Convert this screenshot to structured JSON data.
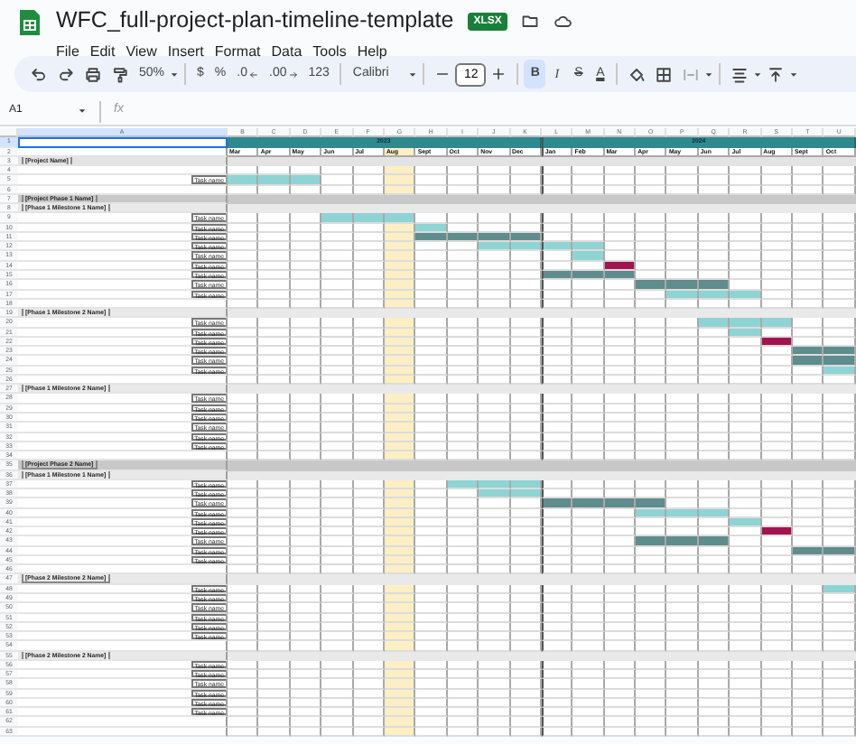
{
  "title": "WFC_full-project-plan-timeline-template",
  "file_badge": "XLSX",
  "menu": [
    "File",
    "Edit",
    "View",
    "Insert",
    "Format",
    "Data",
    "Tools",
    "Help"
  ],
  "toolbar": {
    "zoom": "50%",
    "currency": "$",
    "percent": "%",
    "decrease_decimal": ".0",
    "increase_decimal": ".00",
    "number_format": "123",
    "font": "Calibri",
    "font_size": "12",
    "styles": [
      {
        "label": "B",
        "kind": "bold",
        "selected": true
      },
      {
        "label": "I",
        "kind": "italic",
        "selected": false
      },
      {
        "label": "S",
        "kind": "strike",
        "selected": false
      },
      {
        "label": "A",
        "kind": "color",
        "selected": false
      }
    ]
  },
  "formula_bar": {
    "cell": "A1",
    "fx": "fx"
  },
  "column_letters": [
    "A",
    "B",
    "C",
    "D",
    "E",
    "F",
    "G",
    "H",
    "I",
    "J",
    "K",
    "L",
    "M",
    "N",
    "O",
    "P",
    "Q",
    "R",
    "S",
    "T",
    "U"
  ],
  "years": [
    {
      "label": "2023",
      "months": [
        {
          "label": "Mar",
          "highlighted": false
        },
        {
          "label": "Apr",
          "highlighted": false
        },
        {
          "label": "May",
          "highlighted": false
        },
        {
          "label": "Jun",
          "highlighted": false
        },
        {
          "label": "Jul",
          "highlighted": false
        },
        {
          "label": "Aug",
          "highlighted": true
        },
        {
          "label": "Sept",
          "highlighted": false
        },
        {
          "label": "Oct",
          "highlighted": false
        },
        {
          "label": "Nov",
          "highlighted": false
        },
        {
          "label": "Dec",
          "highlighted": false
        }
      ]
    },
    {
      "label": "2024",
      "months": [
        {
          "label": "Jan",
          "highlighted": false
        },
        {
          "label": "Feb",
          "highlighted": false
        },
        {
          "label": "Mar",
          "highlighted": false
        },
        {
          "label": "Apr",
          "highlighted": false
        },
        {
          "label": "May",
          "highlighted": false
        },
        {
          "label": "Jun",
          "highlighted": false
        },
        {
          "label": "Jul",
          "highlighted": false
        },
        {
          "label": "Aug",
          "highlighted": false
        },
        {
          "label": "Sept",
          "highlighted": false
        },
        {
          "label": "Oct",
          "highlighted": false
        }
      ]
    }
  ],
  "rows": [
    {
      "num": "1",
      "kind": "years",
      "selected": true
    },
    {
      "num": "2",
      "kind": "months",
      "selected": false
    },
    {
      "num": "3",
      "kind": "project",
      "label": "[Project Name]",
      "selected": false
    },
    {
      "num": "4",
      "kind": "blank",
      "selected": false
    },
    {
      "num": "5",
      "kind": "task",
      "label": "Task name",
      "selected": false,
      "color": "#8fd4d4",
      "shaded": [
        true,
        true,
        true,
        false,
        false,
        false,
        false,
        false,
        false,
        false,
        false,
        false,
        false,
        false,
        false,
        false,
        false,
        false,
        false,
        false
      ]
    },
    {
      "num": "6",
      "kind": "blank",
      "selected": false
    },
    {
      "num": "7",
      "kind": "phase",
      "label": "[Project Phase 1 Name]",
      "selected": false
    },
    {
      "num": "8",
      "kind": "milestone",
      "label": "[Phase 1 Milestone 1 Name]",
      "selected": false
    },
    {
      "num": "9",
      "kind": "task",
      "label": "Task name",
      "selected": false,
      "color": "#8fd4d4",
      "shaded": [
        false,
        false,
        false,
        true,
        true,
        true,
        false,
        false,
        false,
        false,
        false,
        false,
        false,
        false,
        false,
        false,
        false,
        false,
        false,
        false
      ]
    },
    {
      "num": "10",
      "kind": "task",
      "label": "Task name",
      "selected": false,
      "color": "#8fd4d4",
      "shaded": [
        false,
        false,
        false,
        false,
        false,
        false,
        true,
        false,
        false,
        false,
        false,
        false,
        false,
        false,
        false,
        false,
        false,
        false,
        false,
        false
      ]
    },
    {
      "num": "11",
      "kind": "task",
      "label": "Task name",
      "selected": false,
      "color": "#5f8c8c",
      "shaded": [
        false,
        false,
        false,
        false,
        false,
        false,
        true,
        true,
        true,
        true,
        false,
        false,
        false,
        false,
        false,
        false,
        false,
        false,
        false,
        false
      ]
    },
    {
      "num": "12",
      "kind": "task",
      "label": "Task name",
      "selected": false,
      "color": "#8fd4d4",
      "shaded": [
        false,
        false,
        false,
        false,
        false,
        false,
        false,
        false,
        true,
        true,
        true,
        true,
        false,
        false,
        false,
        false,
        false,
        false,
        false,
        false
      ]
    },
    {
      "num": "13",
      "kind": "task",
      "label": "Task name",
      "selected": false,
      "color": "#8fd4d4",
      "shaded": [
        false,
        false,
        false,
        false,
        false,
        false,
        false,
        false,
        false,
        false,
        false,
        true,
        false,
        false,
        false,
        false,
        false,
        false,
        false,
        false
      ]
    },
    {
      "num": "14",
      "kind": "task",
      "label": "Task name",
      "selected": false,
      "color": "#a3134f",
      "shaded": [
        false,
        false,
        false,
        false,
        false,
        false,
        false,
        false,
        false,
        false,
        false,
        false,
        true,
        false,
        false,
        false,
        false,
        false,
        false,
        false
      ]
    },
    {
      "num": "15",
      "kind": "task",
      "label": "Task name",
      "selected": false,
      "color": "#5f8c8c",
      "shaded": [
        false,
        false,
        false,
        false,
        false,
        false,
        false,
        false,
        false,
        false,
        true,
        true,
        true,
        false,
        false,
        false,
        false,
        false,
        false,
        false
      ]
    },
    {
      "num": "16",
      "kind": "task",
      "label": "Task name",
      "selected": false,
      "color": "#5f8c8c",
      "shaded": [
        false,
        false,
        false,
        false,
        false,
        false,
        false,
        false,
        false,
        false,
        false,
        false,
        false,
        true,
        true,
        true,
        false,
        false,
        false,
        false
      ]
    },
    {
      "num": "17",
      "kind": "task",
      "label": "Task name",
      "selected": false,
      "color": "#8fd4d4",
      "shaded": [
        false,
        false,
        false,
        false,
        false,
        false,
        false,
        false,
        false,
        false,
        false,
        false,
        false,
        false,
        true,
        true,
        true,
        false,
        false,
        false
      ]
    },
    {
      "num": "18",
      "kind": "blank",
      "selected": false
    },
    {
      "num": "19",
      "kind": "milestone",
      "label": "[Phase 1 Milestone 2 Name]",
      "selected": false
    },
    {
      "num": "20",
      "kind": "task",
      "label": "Task name",
      "selected": false,
      "color": "#8fd4d4",
      "shaded": [
        false,
        false,
        false,
        false,
        false,
        false,
        false,
        false,
        false,
        false,
        false,
        false,
        false,
        false,
        false,
        true,
        true,
        true,
        false,
        false
      ]
    },
    {
      "num": "21",
      "kind": "task",
      "label": "Task name",
      "selected": false,
      "color": "#8fd4d4",
      "shaded": [
        false,
        false,
        false,
        false,
        false,
        false,
        false,
        false,
        false,
        false,
        false,
        false,
        false,
        false,
        false,
        false,
        true,
        false,
        false,
        false
      ]
    },
    {
      "num": "22",
      "kind": "task",
      "label": "Task name",
      "selected": false,
      "color": "#a3134f",
      "shaded": [
        false,
        false,
        false,
        false,
        false,
        false,
        false,
        false,
        false,
        false,
        false,
        false,
        false,
        false,
        false,
        false,
        false,
        true,
        false,
        false
      ]
    },
    {
      "num": "23",
      "kind": "task",
      "label": "Task name",
      "selected": false,
      "color": "#5f8c8c",
      "shaded": [
        false,
        false,
        false,
        false,
        false,
        false,
        false,
        false,
        false,
        false,
        false,
        false,
        false,
        false,
        false,
        false,
        false,
        false,
        true,
        true
      ]
    },
    {
      "num": "24",
      "kind": "task",
      "label": "Task name",
      "selected": false,
      "color": "#5f8c8c",
      "shaded": [
        false,
        false,
        false,
        false,
        false,
        false,
        false,
        false,
        false,
        false,
        false,
        false,
        false,
        false,
        false,
        false,
        false,
        false,
        true,
        true
      ]
    },
    {
      "num": "25",
      "kind": "task",
      "label": "Task name",
      "selected": false,
      "color": "#8fd4d4",
      "shaded": [
        false,
        false,
        false,
        false,
        false,
        false,
        false,
        false,
        false,
        false,
        false,
        false,
        false,
        false,
        false,
        false,
        false,
        false,
        false,
        true
      ]
    },
    {
      "num": "26",
      "kind": "blank",
      "selected": false
    },
    {
      "num": "27",
      "kind": "milestone",
      "label": "[Phase 1 Milestone 2 Name]",
      "selected": false
    },
    {
      "num": "28",
      "kind": "task",
      "label": "Task name",
      "selected": false
    },
    {
      "num": "29",
      "kind": "task",
      "label": "Task name",
      "selected": false
    },
    {
      "num": "30",
      "kind": "task",
      "label": "Task name",
      "selected": false
    },
    {
      "num": "31",
      "kind": "task",
      "label": "Task name",
      "selected": false
    },
    {
      "num": "32",
      "kind": "task",
      "label": "Task name",
      "selected": false
    },
    {
      "num": "33",
      "kind": "task",
      "label": "Task name",
      "selected": false
    },
    {
      "num": "34",
      "kind": "blank",
      "selected": false
    },
    {
      "num": "35",
      "kind": "phase",
      "label": "[Project Phase 2 Name]",
      "selected": false
    },
    {
      "num": "36",
      "kind": "milestone",
      "label": "[Phase 1 Milestone 1 Name]",
      "selected": false
    },
    {
      "num": "37",
      "kind": "task",
      "label": "Task name",
      "selected": false,
      "color": "#8fd4d4",
      "shaded": [
        false,
        false,
        false,
        false,
        false,
        false,
        false,
        true,
        true,
        true,
        false,
        false,
        false,
        false,
        false,
        false,
        false,
        false,
        false,
        false
      ]
    },
    {
      "num": "38",
      "kind": "task",
      "label": "Task name",
      "selected": false,
      "color": "#8fd4d4",
      "shaded": [
        false,
        false,
        false,
        false,
        false,
        false,
        false,
        false,
        true,
        true,
        false,
        false,
        false,
        false,
        false,
        false,
        false,
        false,
        false,
        false
      ]
    },
    {
      "num": "39",
      "kind": "task",
      "label": "Task name",
      "selected": false,
      "color": "#5f8c8c",
      "shaded": [
        false,
        false,
        false,
        false,
        false,
        false,
        false,
        false,
        false,
        false,
        true,
        true,
        true,
        true,
        false,
        false,
        false,
        false,
        false,
        false
      ]
    },
    {
      "num": "40",
      "kind": "task",
      "label": "Task name",
      "selected": false,
      "color": "#8fd4d4",
      "shaded": [
        false,
        false,
        false,
        false,
        false,
        false,
        false,
        false,
        false,
        false,
        false,
        false,
        false,
        true,
        true,
        true,
        false,
        false,
        false,
        false
      ]
    },
    {
      "num": "41",
      "kind": "task",
      "label": "Task name",
      "selected": false,
      "color": "#8fd4d4",
      "shaded": [
        false,
        false,
        false,
        false,
        false,
        false,
        false,
        false,
        false,
        false,
        false,
        false,
        false,
        false,
        false,
        false,
        true,
        false,
        false,
        false
      ]
    },
    {
      "num": "42",
      "kind": "task",
      "label": "Task name",
      "selected": false,
      "color": "#a3134f",
      "shaded": [
        false,
        false,
        false,
        false,
        false,
        false,
        false,
        false,
        false,
        false,
        false,
        false,
        false,
        false,
        false,
        false,
        false,
        true,
        false,
        false
      ]
    },
    {
      "num": "43",
      "kind": "task",
      "label": "Task name",
      "selected": false,
      "color": "#5f8c8c",
      "shaded": [
        false,
        false,
        false,
        false,
        false,
        false,
        false,
        false,
        false,
        false,
        false,
        false,
        false,
        true,
        true,
        true,
        false,
        false,
        false,
        false
      ]
    },
    {
      "num": "44",
      "kind": "task",
      "label": "Task name",
      "selected": false,
      "color": "#5f8c8c",
      "shaded": [
        false,
        false,
        false,
        false,
        false,
        false,
        false,
        false,
        false,
        false,
        false,
        false,
        false,
        false,
        false,
        false,
        false,
        false,
        true,
        true
      ]
    },
    {
      "num": "45",
      "kind": "task",
      "label": "Task name",
      "selected": false
    },
    {
      "num": "46",
      "kind": "blank",
      "selected": false
    },
    {
      "num": "47",
      "kind": "milestone",
      "label": "[Phase 2 Milestone 2 Name]",
      "selected": false
    },
    {
      "num": "48",
      "kind": "task",
      "label": "Task name",
      "selected": false,
      "color": "#8fd4d4",
      "shaded": [
        false,
        false,
        false,
        false,
        false,
        false,
        false,
        false,
        false,
        false,
        false,
        false,
        false,
        false,
        false,
        false,
        false,
        false,
        false,
        true
      ]
    },
    {
      "num": "49",
      "kind": "task",
      "label": "Task name",
      "selected": false
    },
    {
      "num": "50",
      "kind": "task",
      "label": "Task name",
      "selected": false
    },
    {
      "num": "51",
      "kind": "task",
      "label": "Task name",
      "selected": false
    },
    {
      "num": "52",
      "kind": "task",
      "label": "Task name",
      "selected": false
    },
    {
      "num": "53",
      "kind": "task",
      "label": "Task name",
      "selected": false
    },
    {
      "num": "54",
      "kind": "blank",
      "selected": false
    },
    {
      "num": "55",
      "kind": "milestone",
      "label": "[Phase 2 Milestone 2 Name]",
      "selected": false
    },
    {
      "num": "56",
      "kind": "task",
      "label": "Task name",
      "selected": false
    },
    {
      "num": "57",
      "kind": "task",
      "label": "Task name",
      "selected": false
    },
    {
      "num": "58",
      "kind": "task",
      "label": "Task name",
      "selected": false
    },
    {
      "num": "59",
      "kind": "task",
      "label": "Task name",
      "selected": false
    },
    {
      "num": "60",
      "kind": "task",
      "label": "Task name",
      "selected": false
    },
    {
      "num": "61",
      "kind": "task",
      "label": "Task name",
      "selected": false
    },
    {
      "num": "62",
      "kind": "blank",
      "selected": false
    },
    {
      "num": "63",
      "kind": "blank",
      "selected": false
    }
  ]
}
